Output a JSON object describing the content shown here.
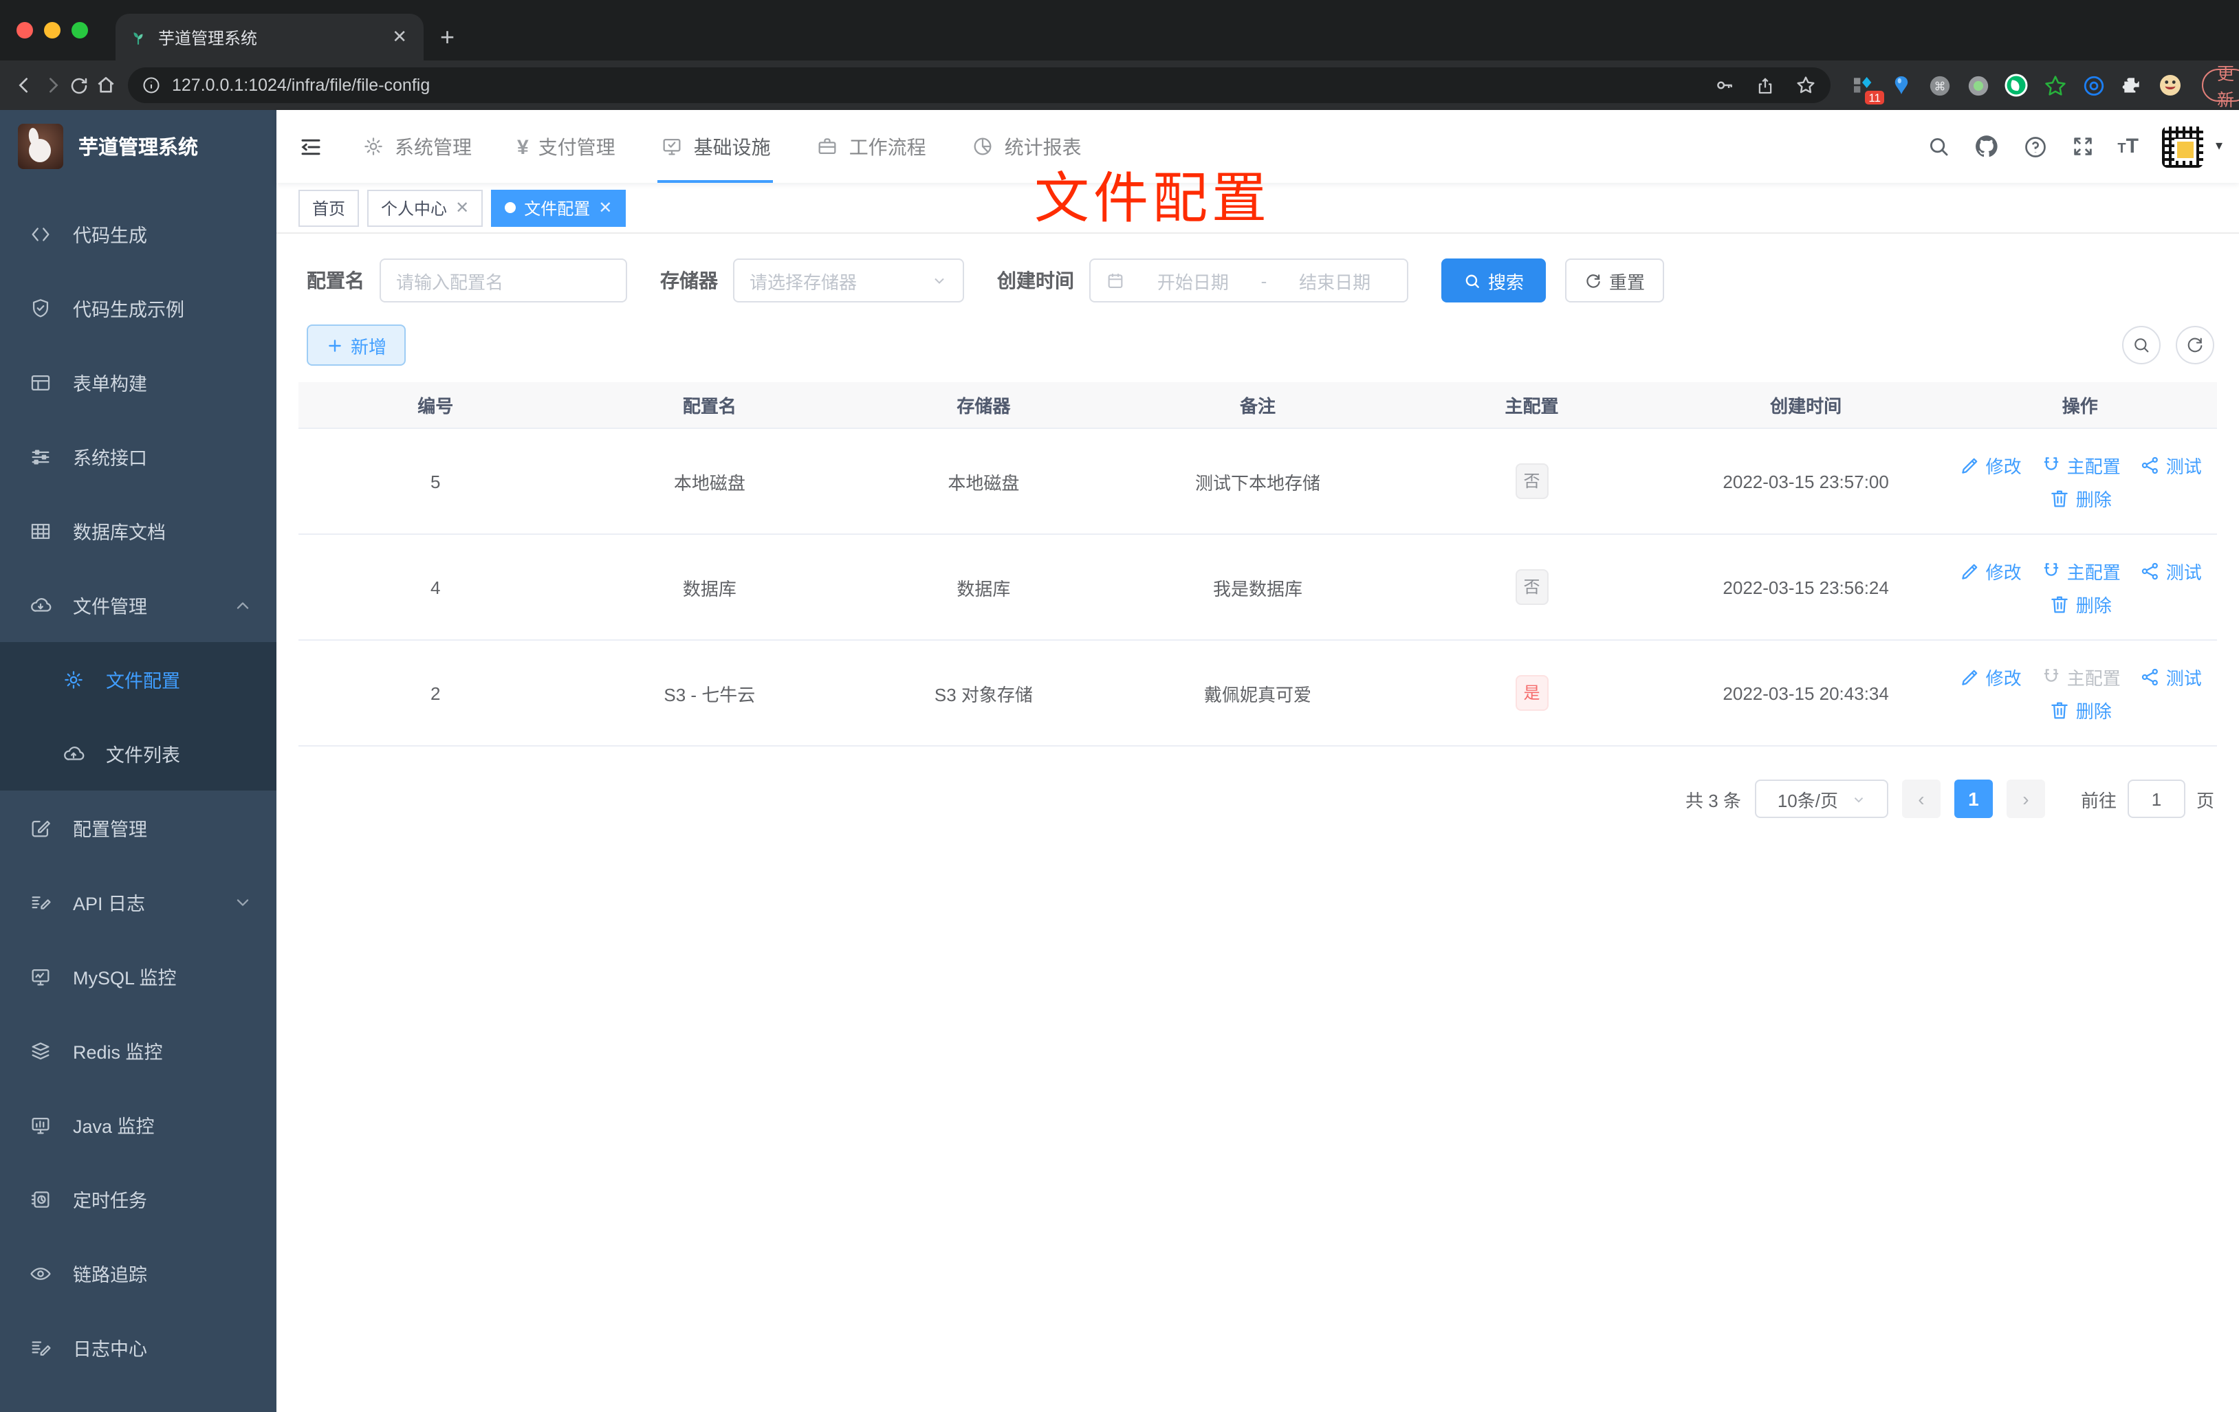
{
  "browser": {
    "tab_title": "芋道管理系统",
    "url": "127.0.0.1:1024/infra/file/file-config",
    "update_label": "更新",
    "ext_badge": "11"
  },
  "overlay_title": "文件配置",
  "sidebar": {
    "app_title": "芋道管理系统",
    "items": [
      {
        "label": "代码生成",
        "icon": "code-icon"
      },
      {
        "label": "代码生成示例",
        "icon": "shield-check-icon"
      },
      {
        "label": "表单构建",
        "icon": "form-icon"
      },
      {
        "label": "系统接口",
        "icon": "sliders-icon"
      },
      {
        "label": "数据库文档",
        "icon": "grid-icon"
      },
      {
        "label": "文件管理",
        "icon": "cloud-download-icon",
        "group": true,
        "chevron": "up"
      },
      {
        "label": "文件配置",
        "icon": "gear-icon",
        "sub": true,
        "active": true
      },
      {
        "label": "文件列表",
        "icon": "cloud-upload-icon",
        "sub": true
      },
      {
        "label": "配置管理",
        "icon": "edit-square-icon"
      },
      {
        "label": "API 日志",
        "icon": "doc-edit-icon",
        "chevron": "down"
      },
      {
        "label": "MySQL 监控",
        "icon": "monitor-chart-icon"
      },
      {
        "label": "Redis 监控",
        "icon": "layers-icon"
      },
      {
        "label": "Java 监控",
        "icon": "monitor-icon"
      },
      {
        "label": "定时任务",
        "icon": "schedule-icon"
      },
      {
        "label": "链路追踪",
        "icon": "eye-icon"
      },
      {
        "label": "日志中心",
        "icon": "log-edit-icon"
      }
    ]
  },
  "topnav": {
    "items": [
      {
        "label": "系统管理",
        "icon": "gear-icon",
        "active": false
      },
      {
        "label": "支付管理",
        "icon": "yen-icon",
        "active": false
      },
      {
        "label": "基础设施",
        "icon": "monitor-check-icon",
        "active": true
      },
      {
        "label": "工作流程",
        "icon": "briefcase-icon",
        "active": false
      },
      {
        "label": "统计报表",
        "icon": "pie-chart-icon",
        "active": false
      }
    ]
  },
  "tags": [
    {
      "label": "首页",
      "closable": false,
      "active": false
    },
    {
      "label": "个人中心",
      "closable": true,
      "active": false
    },
    {
      "label": "文件配置",
      "closable": true,
      "active": true
    }
  ],
  "filter": {
    "config_label": "配置名",
    "config_placeholder": "请输入配置名",
    "storage_label": "存储器",
    "storage_placeholder": "请选择存储器",
    "created_label": "创建时间",
    "date_start": "开始日期",
    "date_sep": "-",
    "date_end": "结束日期",
    "search_label": "搜索",
    "reset_label": "重置"
  },
  "toolbar": {
    "add_label": "新增"
  },
  "table": {
    "headers": [
      "编号",
      "配置名",
      "存储器",
      "备注",
      "主配置",
      "创建时间",
      "操作"
    ],
    "action_labels": {
      "edit": "修改",
      "master": "主配置",
      "test": "测试",
      "delete": "删除"
    },
    "rows": [
      {
        "id": "5",
        "name": "本地磁盘",
        "storage": "本地磁盘",
        "remark": "测试下本地存储",
        "master": "否",
        "master_type": "info",
        "created": "2022-03-15 23:57:00",
        "master_action_disabled": false
      },
      {
        "id": "4",
        "name": "数据库",
        "storage": "数据库",
        "remark": "我是数据库",
        "master": "否",
        "master_type": "info",
        "created": "2022-03-15 23:56:24",
        "master_action_disabled": false
      },
      {
        "id": "2",
        "name": "S3 - 七牛云",
        "storage": "S3 对象存储",
        "remark": "戴佩妮真可爱",
        "master": "是",
        "master_type": "danger",
        "created": "2022-03-15 20:43:34",
        "master_action_disabled": true
      }
    ]
  },
  "pagination": {
    "total": "共 3 条",
    "page_size": "10条/页",
    "current": "1",
    "goto_label": "前往",
    "goto_value": "1",
    "page_unit": "页"
  },
  "colors": {
    "accent": "#409eff",
    "danger": "#f56c6c",
    "annotation": "#fe2c02",
    "sidebar_bg": "#36495d"
  }
}
